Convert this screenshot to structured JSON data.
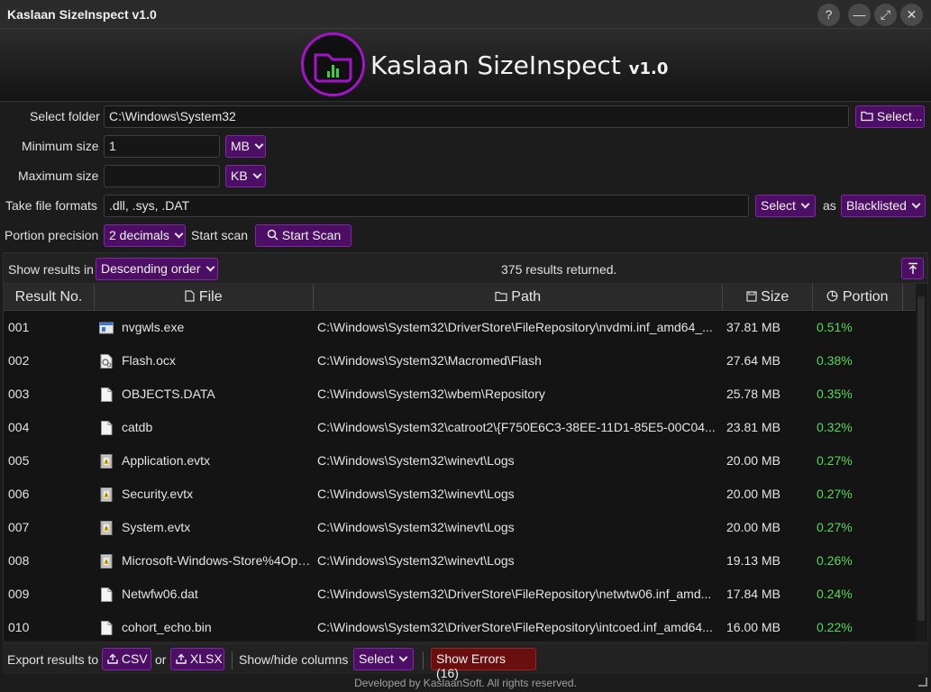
{
  "window": {
    "title": "Kaslaan SizeInspect v1.0",
    "help": "?",
    "minimize": "—",
    "maximize": "⤢",
    "close": "✕"
  },
  "header": {
    "app_name": "Kaslaan SizeInspect",
    "version": "v1.0",
    "accent": "#a314c8"
  },
  "form": {
    "folder_label": "Select folder",
    "folder_value": "C:\\Windows\\System32",
    "folder_button": "Select...",
    "min_label": "Minimum size",
    "min_value": "1",
    "min_unit": "MB",
    "max_label": "Maximum size",
    "max_value": "",
    "max_unit": "KB",
    "formats_label": "Take file formats",
    "formats_value": ".dll, .sys, .DAT",
    "formats_select": "Select",
    "as_label": "as",
    "formats_mode": "Blacklisted",
    "precision_label": "Portion precision",
    "precision_value": "2 decimals",
    "start_label": "Start scan",
    "start_button": "Start Scan"
  },
  "results": {
    "order_label": "Show results in",
    "order_value": "Descending order",
    "summary": "375 results returned.",
    "columns": [
      "Result No.",
      "File",
      "Path",
      "Size",
      "Portion"
    ],
    "rows": [
      {
        "no": "001",
        "file": "nvgwls.exe",
        "icon": "exe-icon",
        "path": "C:\\Windows\\System32\\DriverStore\\FileRepository\\nvdmi.inf_amd64_...",
        "size": "37.81 MB",
        "portion": "0.51%"
      },
      {
        "no": "002",
        "file": "Flash.ocx",
        "icon": "ocx-icon",
        "path": "C:\\Windows\\System32\\Macromed\\Flash",
        "size": "27.64 MB",
        "portion": "0.38%"
      },
      {
        "no": "003",
        "file": "OBJECTS.DATA",
        "icon": "file-icon",
        "path": "C:\\Windows\\System32\\wbem\\Repository",
        "size": "25.78 MB",
        "portion": "0.35%"
      },
      {
        "no": "004",
        "file": "catdb",
        "icon": "file-icon",
        "path": "C:\\Windows\\System32\\catroot2\\{F750E6C3-38EE-11D1-85E5-00C04...",
        "size": "23.81 MB",
        "portion": "0.32%"
      },
      {
        "no": "005",
        "file": "Application.evtx",
        "icon": "evtx-icon",
        "path": "C:\\Windows\\System32\\winevt\\Logs",
        "size": "20.00 MB",
        "portion": "0.27%"
      },
      {
        "no": "006",
        "file": "Security.evtx",
        "icon": "evtx-icon",
        "path": "C:\\Windows\\System32\\winevt\\Logs",
        "size": "20.00 MB",
        "portion": "0.27%"
      },
      {
        "no": "007",
        "file": "System.evtx",
        "icon": "evtx-icon",
        "path": "C:\\Windows\\System32\\winevt\\Logs",
        "size": "20.00 MB",
        "portion": "0.27%"
      },
      {
        "no": "008",
        "file": "Microsoft-Windows-Store%4Ope...",
        "icon": "evtx-icon",
        "path": "C:\\Windows\\System32\\winevt\\Logs",
        "size": "19.13 MB",
        "portion": "0.26%"
      },
      {
        "no": "009",
        "file": "Netwfw06.dat",
        "icon": "file-icon",
        "path": "C:\\Windows\\System32\\DriverStore\\FileRepository\\netwtw06.inf_amd...",
        "size": "17.84 MB",
        "portion": "0.24%"
      },
      {
        "no": "010",
        "file": "cohort_echo.bin",
        "icon": "file-icon",
        "path": "C:\\Windows\\System32\\DriverStore\\FileRepository\\intcoed.inf_amd64...",
        "size": "16.00 MB",
        "portion": "0.22%"
      }
    ]
  },
  "bottom": {
    "export_label": "Export results to",
    "csv": "CSV",
    "or": "or",
    "xlsx": "XLSX",
    "columns_label": "Show/hide columns",
    "columns_select": "Select",
    "errors": "Show Errors (16)"
  },
  "footer": "Developed by KaslaanSoft. All rights reserved."
}
